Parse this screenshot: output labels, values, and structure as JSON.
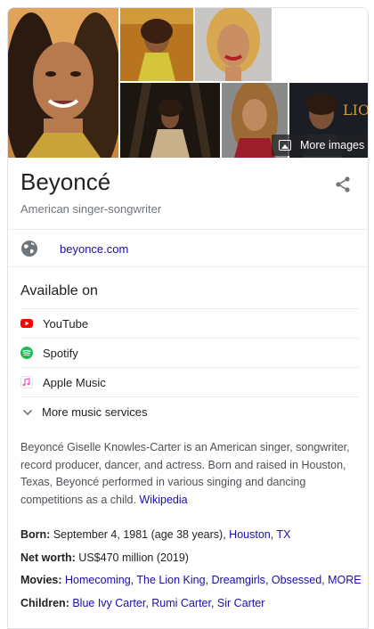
{
  "images": {
    "more_label": "More images",
    "tiles": [
      "portrait-gold-dress",
      "lion-king-premiere",
      "red-lipstick-smile",
      "stage-performance",
      "red-carpet-red-top",
      "lion-king-side-profile"
    ],
    "watermark_text": "LION KING"
  },
  "entity": {
    "name": "Beyoncé",
    "description": "American singer-songwriter",
    "share_icon": "share-icon"
  },
  "website": {
    "icon": "globe-icon",
    "label": "beyonce.com"
  },
  "available_on": {
    "title": "Available on",
    "services": [
      {
        "label": "YouTube",
        "icon": "youtube-icon",
        "color": "#ff0000"
      },
      {
        "label": "Spotify",
        "icon": "spotify-icon",
        "color": "#1db954"
      },
      {
        "label": "Apple Music",
        "icon": "apple-music-icon",
        "color": "#fa57c1"
      }
    ],
    "more_label": "More music services"
  },
  "about": {
    "text": "Beyoncé Giselle Knowles-Carter is an American singer, songwriter, record producer, dancer, and actress. Born and raised in Houston, Texas, Beyoncé performed in various singing and dancing competitions as a child.",
    "source_link": "Wikipedia"
  },
  "facts": {
    "born": {
      "label": "Born:",
      "text": "September 4, 1981 (age 38 years),",
      "link1": "Houston",
      "sep": ",",
      "link2": "TX"
    },
    "net_worth": {
      "label": "Net worth:",
      "text": "US$470 million (2019)"
    },
    "movies": {
      "label": "Movies:",
      "items": [
        "Homecoming",
        "The Lion King",
        "Dreamgirls",
        "Obsessed"
      ],
      "more": "MORE"
    },
    "children": {
      "label": "Children:",
      "items": [
        "Blue Ivy Carter",
        "Rumi Carter",
        "Sir Carter"
      ]
    }
  },
  "colors": {
    "link": "#1a0dab",
    "muted": "#70757a",
    "divider": "#ebebeb"
  }
}
